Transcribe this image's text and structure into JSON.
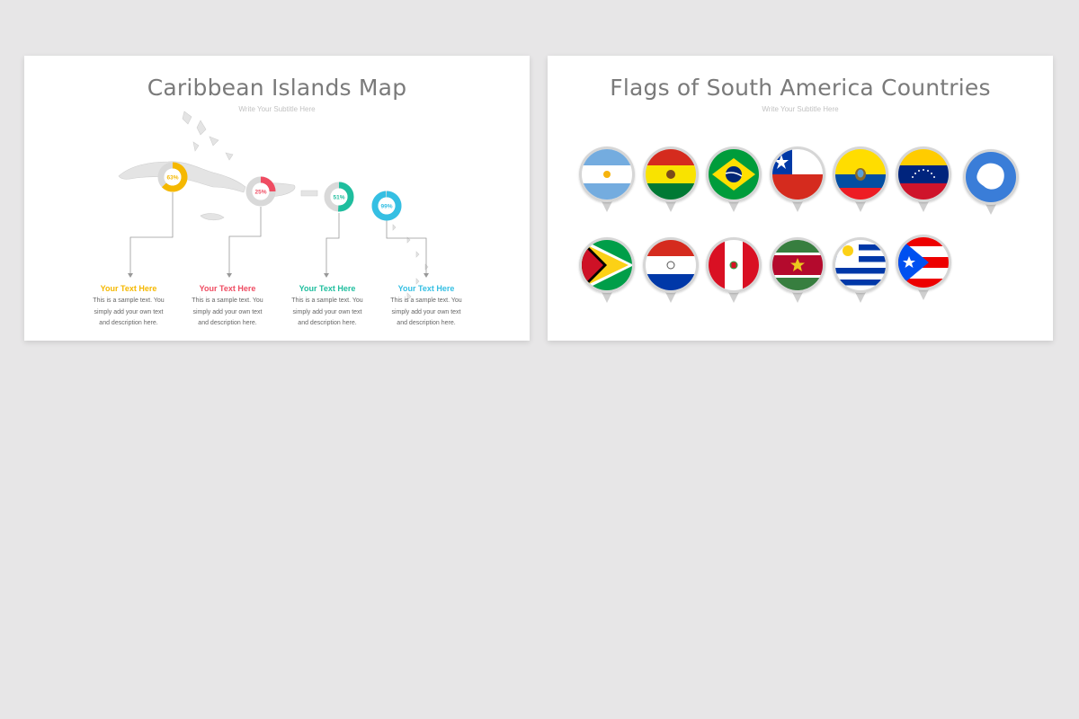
{
  "slides": [
    {
      "title": "Caribbean Islands Map",
      "subtitle": "Write Your Subtitle Here",
      "markers": [
        {
          "percent_text": "63%",
          "value": 63,
          "color": "#f5b800"
        },
        {
          "percent_text": "25%",
          "value": 25,
          "color": "#ef4c62"
        },
        {
          "percent_text": "51%",
          "value": 51,
          "color": "#1fbe9e"
        },
        {
          "percent_text": "99%",
          "value": 99,
          "color": "#35bfe3"
        }
      ],
      "captions": [
        {
          "title": "Your Text Here",
          "body_lines": [
            "This is a sample text. You",
            "simply add your own text",
            "and description here."
          ],
          "color": "#f5b800"
        },
        {
          "title": "Your Text Here",
          "body_lines": [
            "This is a sample text. You",
            "simply add your own text",
            "and description here."
          ],
          "color": "#ef4c62"
        },
        {
          "title": "Your Text Here",
          "body_lines": [
            "This is a sample text. You",
            "simply add your own text",
            "and description here."
          ],
          "color": "#1fbe9e"
        },
        {
          "title": "Your Text Here",
          "body_lines": [
            "This is a sample text. You",
            "simply add your own text",
            "and description here."
          ],
          "color": "#35bfe3"
        }
      ]
    },
    {
      "title": "Flags of South America Countries",
      "subtitle": "Write Your Subtitle Here",
      "flags": [
        {
          "icon": "flag-argentina"
        },
        {
          "icon": "flag-bolivia"
        },
        {
          "icon": "flag-brazil"
        },
        {
          "icon": "flag-chile"
        },
        {
          "icon": "flag-ecuador"
        },
        {
          "icon": "flag-venezuela"
        },
        {
          "icon": "flag-antarctica"
        },
        {
          "icon": "flag-guyana"
        },
        {
          "icon": "flag-paraguay"
        },
        {
          "icon": "flag-peru"
        },
        {
          "icon": "flag-suriname"
        },
        {
          "icon": "flag-uruguay"
        },
        {
          "icon": "flag-puerto-rico"
        }
      ]
    }
  ]
}
